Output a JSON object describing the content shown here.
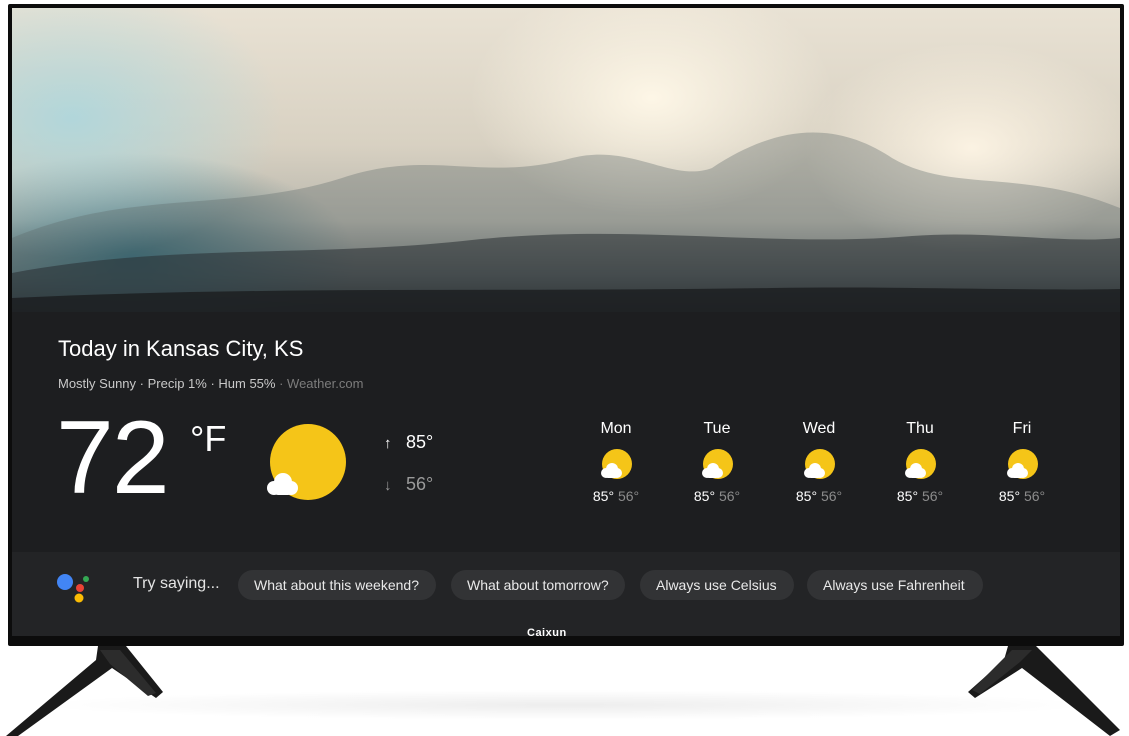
{
  "device": {
    "brand": "Caixun"
  },
  "weather": {
    "title": "Today in Kansas City, KS",
    "summary": "Mostly Sunny · Precip 1% · Hum 55%",
    "source": "Weather.com",
    "current_temp": "72",
    "unit": "°F",
    "current_icon": "sun-with-cloud-icon",
    "high": "85°",
    "low": "56°",
    "forecast": [
      {
        "day": "Mon",
        "hi": "85°",
        "lo": "56°",
        "icon": "partly-sunny-icon"
      },
      {
        "day": "Tue",
        "hi": "85°",
        "lo": "56°",
        "icon": "partly-sunny-icon"
      },
      {
        "day": "Wed",
        "hi": "85°",
        "lo": "56°",
        "icon": "partly-sunny-icon"
      },
      {
        "day": "Thu",
        "hi": "85°",
        "lo": "56°",
        "icon": "partly-sunny-icon"
      },
      {
        "day": "Fri",
        "hi": "85°",
        "lo": "56°",
        "icon": "partly-sunny-icon"
      }
    ]
  },
  "assistant": {
    "prompt": "Try saying...",
    "suggestions": [
      "What about this weekend?",
      "What about tomorrow?",
      "Always use Celsius",
      "Always use Fahrenheit"
    ]
  },
  "colors": {
    "panel": "#1d1e20",
    "sun": "#f5c518",
    "google_blue": "#4285f4",
    "google_red": "#ea4335",
    "google_yellow": "#fbbc04",
    "google_green": "#34a853"
  }
}
